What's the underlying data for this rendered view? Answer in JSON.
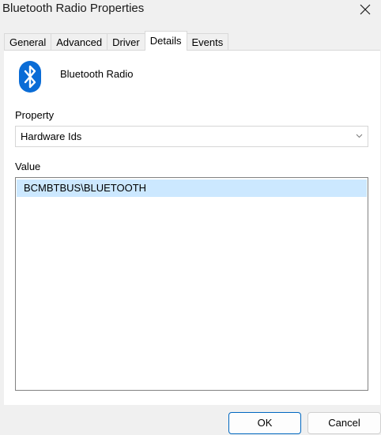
{
  "window": {
    "title": "Bluetooth Radio Properties"
  },
  "tabs": [
    {
      "label": "General"
    },
    {
      "label": "Advanced"
    },
    {
      "label": "Driver"
    },
    {
      "label": "Details",
      "active": true
    },
    {
      "label": "Events"
    }
  ],
  "device": {
    "name": "Bluetooth Radio",
    "icon": "bluetooth-icon",
    "icon_color": "#0a6cd6"
  },
  "property": {
    "label": "Property",
    "selected": "Hardware Ids"
  },
  "value": {
    "label": "Value",
    "items": [
      "BCMBTBUS\\BLUETOOTH"
    ]
  },
  "buttons": {
    "ok": "OK",
    "cancel": "Cancel"
  },
  "colors": {
    "selection": "#cce8ff",
    "accent": "#0067c0"
  }
}
